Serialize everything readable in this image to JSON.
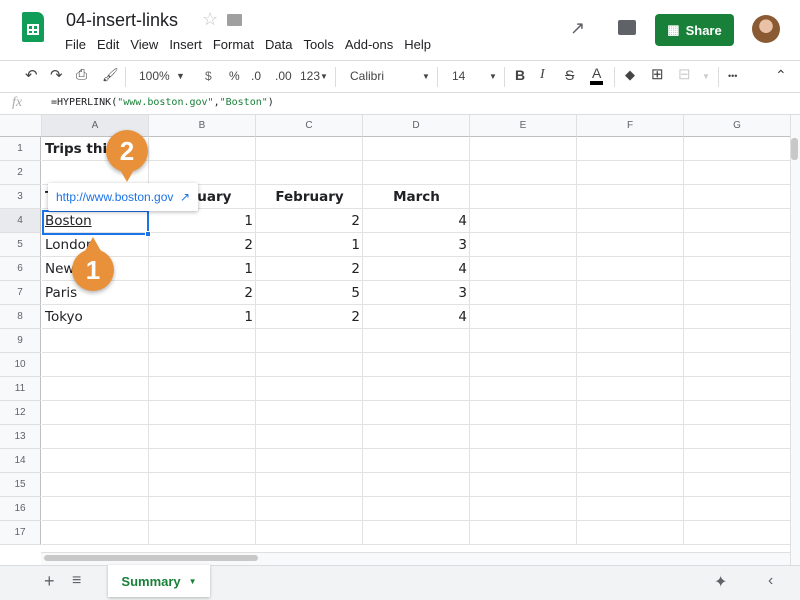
{
  "header": {
    "title": "04-insert-links",
    "menu": [
      "File",
      "Edit",
      "View",
      "Insert",
      "Format",
      "Data",
      "Tools",
      "Add-ons",
      "Help"
    ],
    "share_label": "Share"
  },
  "toolbar": {
    "zoom": "100%",
    "currency": "$",
    "percent": "%",
    "dec_decrease": ".0",
    "dec_increase": ".00",
    "format_more": "123",
    "font": "Calibri",
    "font_size": "14",
    "bold": "B",
    "italic": "I",
    "strike": "S",
    "text_color": "A",
    "more": "•••"
  },
  "formula_bar": {
    "fx": "fx",
    "prefix": "=HYPERLINK(",
    "arg1": "\"www.boston.gov\"",
    "comma": ",",
    "arg2": "\"Boston\"",
    "suffix": ")"
  },
  "columns": [
    "A",
    "B",
    "C",
    "D",
    "E",
    "F",
    "G"
  ],
  "rows": [
    "1",
    "2",
    "3",
    "4",
    "5",
    "6",
    "7",
    "8",
    "9",
    "10",
    "11",
    "12",
    "13",
    "14",
    "15",
    "16",
    "17"
  ],
  "cells": {
    "a1": "Trips this",
    "a3": "T",
    "b3": "January",
    "c3": "February",
    "d3": "March",
    "data": [
      {
        "city": "Boston",
        "jan": "1",
        "feb": "2",
        "mar": "4"
      },
      {
        "city": "London",
        "jan": "2",
        "feb": "1",
        "mar": "3"
      },
      {
        "city": "New",
        "jan": "1",
        "feb": "2",
        "mar": "4"
      },
      {
        "city": "Paris",
        "jan": "2",
        "feb": "5",
        "mar": "3"
      },
      {
        "city": "Tokyo",
        "jan": "1",
        "feb": "2",
        "mar": "4"
      }
    ]
  },
  "tooltip": {
    "url": "http://www.boston.gov"
  },
  "callouts": {
    "one": "1",
    "two": "2"
  },
  "sheet_tab": {
    "label": "Summary"
  },
  "colors": {
    "accent": "#1a73e8",
    "share": "#188038",
    "callout": "#e8903a"
  }
}
